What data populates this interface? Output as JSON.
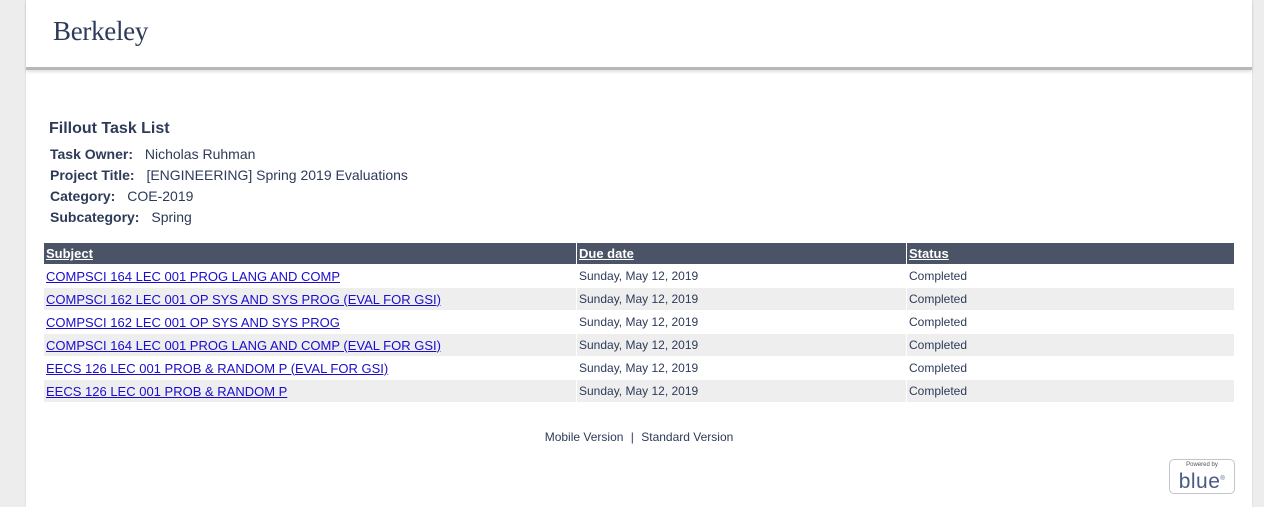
{
  "header": {
    "logo": "Berkeley"
  },
  "task_list": {
    "title": "Fillout Task List",
    "owner_label": "Task Owner:",
    "owner_value": "Nicholas Ruhman",
    "project_label": "Project Title:",
    "project_value": "[ENGINEERING] Spring 2019 Evaluations",
    "category_label": "Category:",
    "category_value": "COE-2019",
    "subcategory_label": "Subcategory:",
    "subcategory_value": "Spring"
  },
  "table": {
    "columns": [
      "Subject",
      "Due date",
      "Status"
    ],
    "rows": [
      {
        "subject": "COMPSCI 164 LEC 001 PROG LANG AND COMP",
        "due": "Sunday, May 12, 2019",
        "status": "Completed"
      },
      {
        "subject": "COMPSCI 162 LEC 001 OP SYS AND SYS PROG (EVAL FOR GSI)",
        "due": "Sunday, May 12, 2019",
        "status": "Completed"
      },
      {
        "subject": "COMPSCI 162 LEC 001 OP SYS AND SYS PROG",
        "due": "Sunday, May 12, 2019",
        "status": "Completed"
      },
      {
        "subject": "COMPSCI 164 LEC 001 PROG LANG AND COMP (EVAL FOR GSI)",
        "due": "Sunday, May 12, 2019",
        "status": "Completed"
      },
      {
        "subject": "EECS 126 LEC 001 PROB & RANDOM P (EVAL FOR GSI)",
        "due": "Sunday, May 12, 2019",
        "status": "Completed"
      },
      {
        "subject": "EECS 126 LEC 001 PROB & RANDOM P",
        "due": "Sunday, May 12, 2019",
        "status": "Completed"
      }
    ]
  },
  "footer": {
    "mobile_link": "Mobile Version",
    "separator": "|",
    "standard_link": "Standard Version",
    "powered_by": "Powered by",
    "brand": "blue",
    "registered": "®"
  }
}
